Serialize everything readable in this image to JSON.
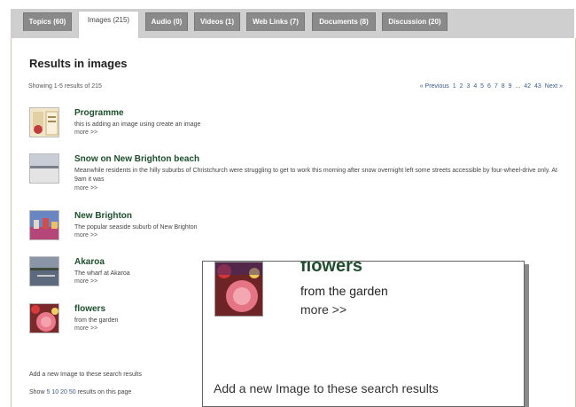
{
  "tabs": [
    {
      "label": "Topics (60)"
    },
    {
      "label": "Images (215)"
    },
    {
      "label": "Audio (0)"
    },
    {
      "label": "Videos (1)"
    },
    {
      "label": "Web Links (7)"
    },
    {
      "label": "Documents (8)"
    },
    {
      "label": "Discussion (20)"
    }
  ],
  "page_title": "Results in images",
  "showing_text": "Showing 1-5 results of 215",
  "pager": {
    "previous": "« Previous",
    "pages": [
      "1",
      "2",
      "3",
      "4",
      "5",
      "6",
      "7",
      "8",
      "9"
    ],
    "ellipsis": "...",
    "last_pages": [
      "42",
      "43"
    ],
    "next": "Next »"
  },
  "results": [
    {
      "title": "Programme",
      "desc": "this is adding an image using create an image",
      "more": "more >>"
    },
    {
      "title": "Snow on New Brighton beach",
      "desc": "Meanwhile residents in the hilly suburbs of Christchurch were struggling to get to work this morning after snow overnight left some streets accessible by four-wheel-drive only. At 9am it was",
      "more": "more >>"
    },
    {
      "title": "New Brighton",
      "desc": "The popular seaside suburb of New Brighton",
      "more": "more >>"
    },
    {
      "title": "Akaroa",
      "desc": "The wharf at Akaroa",
      "more": "more >>"
    },
    {
      "title": "flowers",
      "desc": "from the garden",
      "more": "more >>"
    }
  ],
  "add_new": "Add a new Image to these search results",
  "show_results": {
    "prefix": "Show",
    "options": [
      "5",
      "10",
      "20",
      "50"
    ],
    "suffix": "results on this page"
  },
  "zoom": {
    "title": "flowers",
    "desc": "from the garden",
    "more": "more >>",
    "add_new": "Add a new Image to these search results"
  },
  "colors": {
    "tab_inactive": "#8a8a8a",
    "result_title": "#1c4f2c",
    "link": "#3b5b8f"
  }
}
